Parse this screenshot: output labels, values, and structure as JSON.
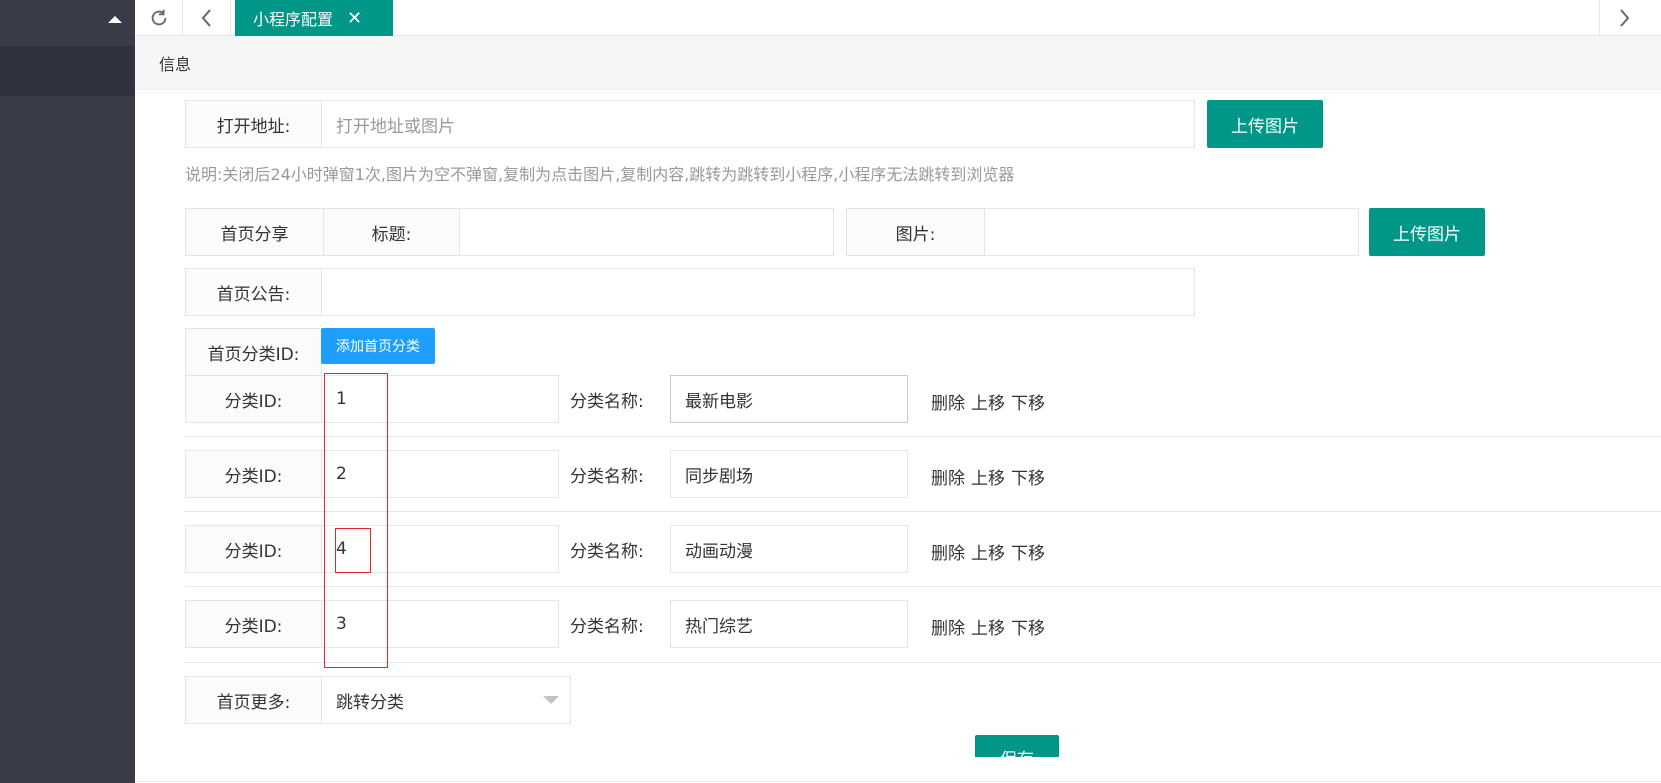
{
  "tabs": {
    "active_label": "小程序配置",
    "close_glyph": "✕"
  },
  "card": {
    "title": "信息"
  },
  "open_address": {
    "label": "打开地址:",
    "placeholder": "打开地址或图片",
    "upload_label": "上传图片",
    "hint": "说明:关闭后24小时弹窗1次,图片为空不弹窗,复制为点击图片,复制内容,跳转为跳转到小程序,小程序无法跳转到浏览器"
  },
  "home_share": {
    "label": "首页分享",
    "title_label": "标题:",
    "title_value": "",
    "image_label": "图片:",
    "image_value": "",
    "upload_label": "上传图片"
  },
  "home_notice": {
    "label": "首页公告:",
    "value": ""
  },
  "home_category": {
    "label": "首页分类ID:",
    "add_label": "添加首页分类",
    "id_label": "分类ID:",
    "name_label": "分类名称:",
    "actions": {
      "delete": "删除",
      "up": "上移",
      "down": "下移"
    },
    "rows": [
      {
        "id": "1",
        "name": "最新电影"
      },
      {
        "id": "2",
        "name": "同步剧场"
      },
      {
        "id": "4",
        "name": "动画动漫"
      },
      {
        "id": "3",
        "name": "热门综艺"
      }
    ]
  },
  "home_more": {
    "label": "首页更多:",
    "selected": "跳转分类"
  },
  "save": {
    "label": "保存"
  },
  "colors": {
    "primary": "#009688",
    "blue": "#1e9fff",
    "sidebar": "#393d49",
    "annotation": "#e8252f"
  },
  "icons": [
    "refresh-icon",
    "chevron-left-icon",
    "close-icon",
    "chevron-right-icon",
    "caret-up-icon",
    "chevron-down-icon"
  ]
}
